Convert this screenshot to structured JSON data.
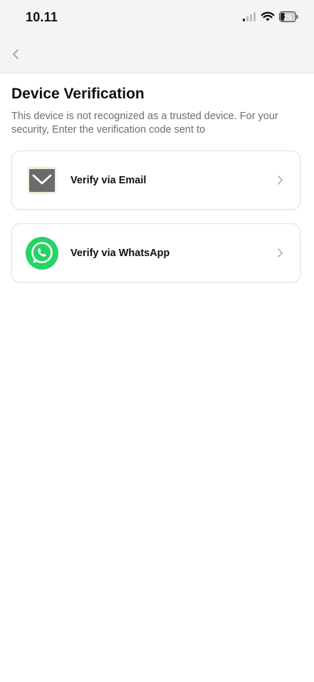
{
  "status_bar": {
    "time": "10.11",
    "battery_level": "25"
  },
  "nav": {
    "back_icon": "chevron-left-icon"
  },
  "page": {
    "title": "Device Verification",
    "description": "This device is not recognized as a trusted device. For your security, Enter the verification code sent to"
  },
  "options": [
    {
      "label": "Verify via Email",
      "icon": "mail-icon",
      "icon_color": "#6b6b6b"
    },
    {
      "label": "Verify via WhatsApp",
      "icon": "whatsapp-icon",
      "icon_color": "#25d366"
    }
  ],
  "colors": {
    "background": "#ffffff",
    "header_background": "#f4f4f4",
    "description_text": "#6e6e6e",
    "card_border": "#e2e2e2"
  }
}
